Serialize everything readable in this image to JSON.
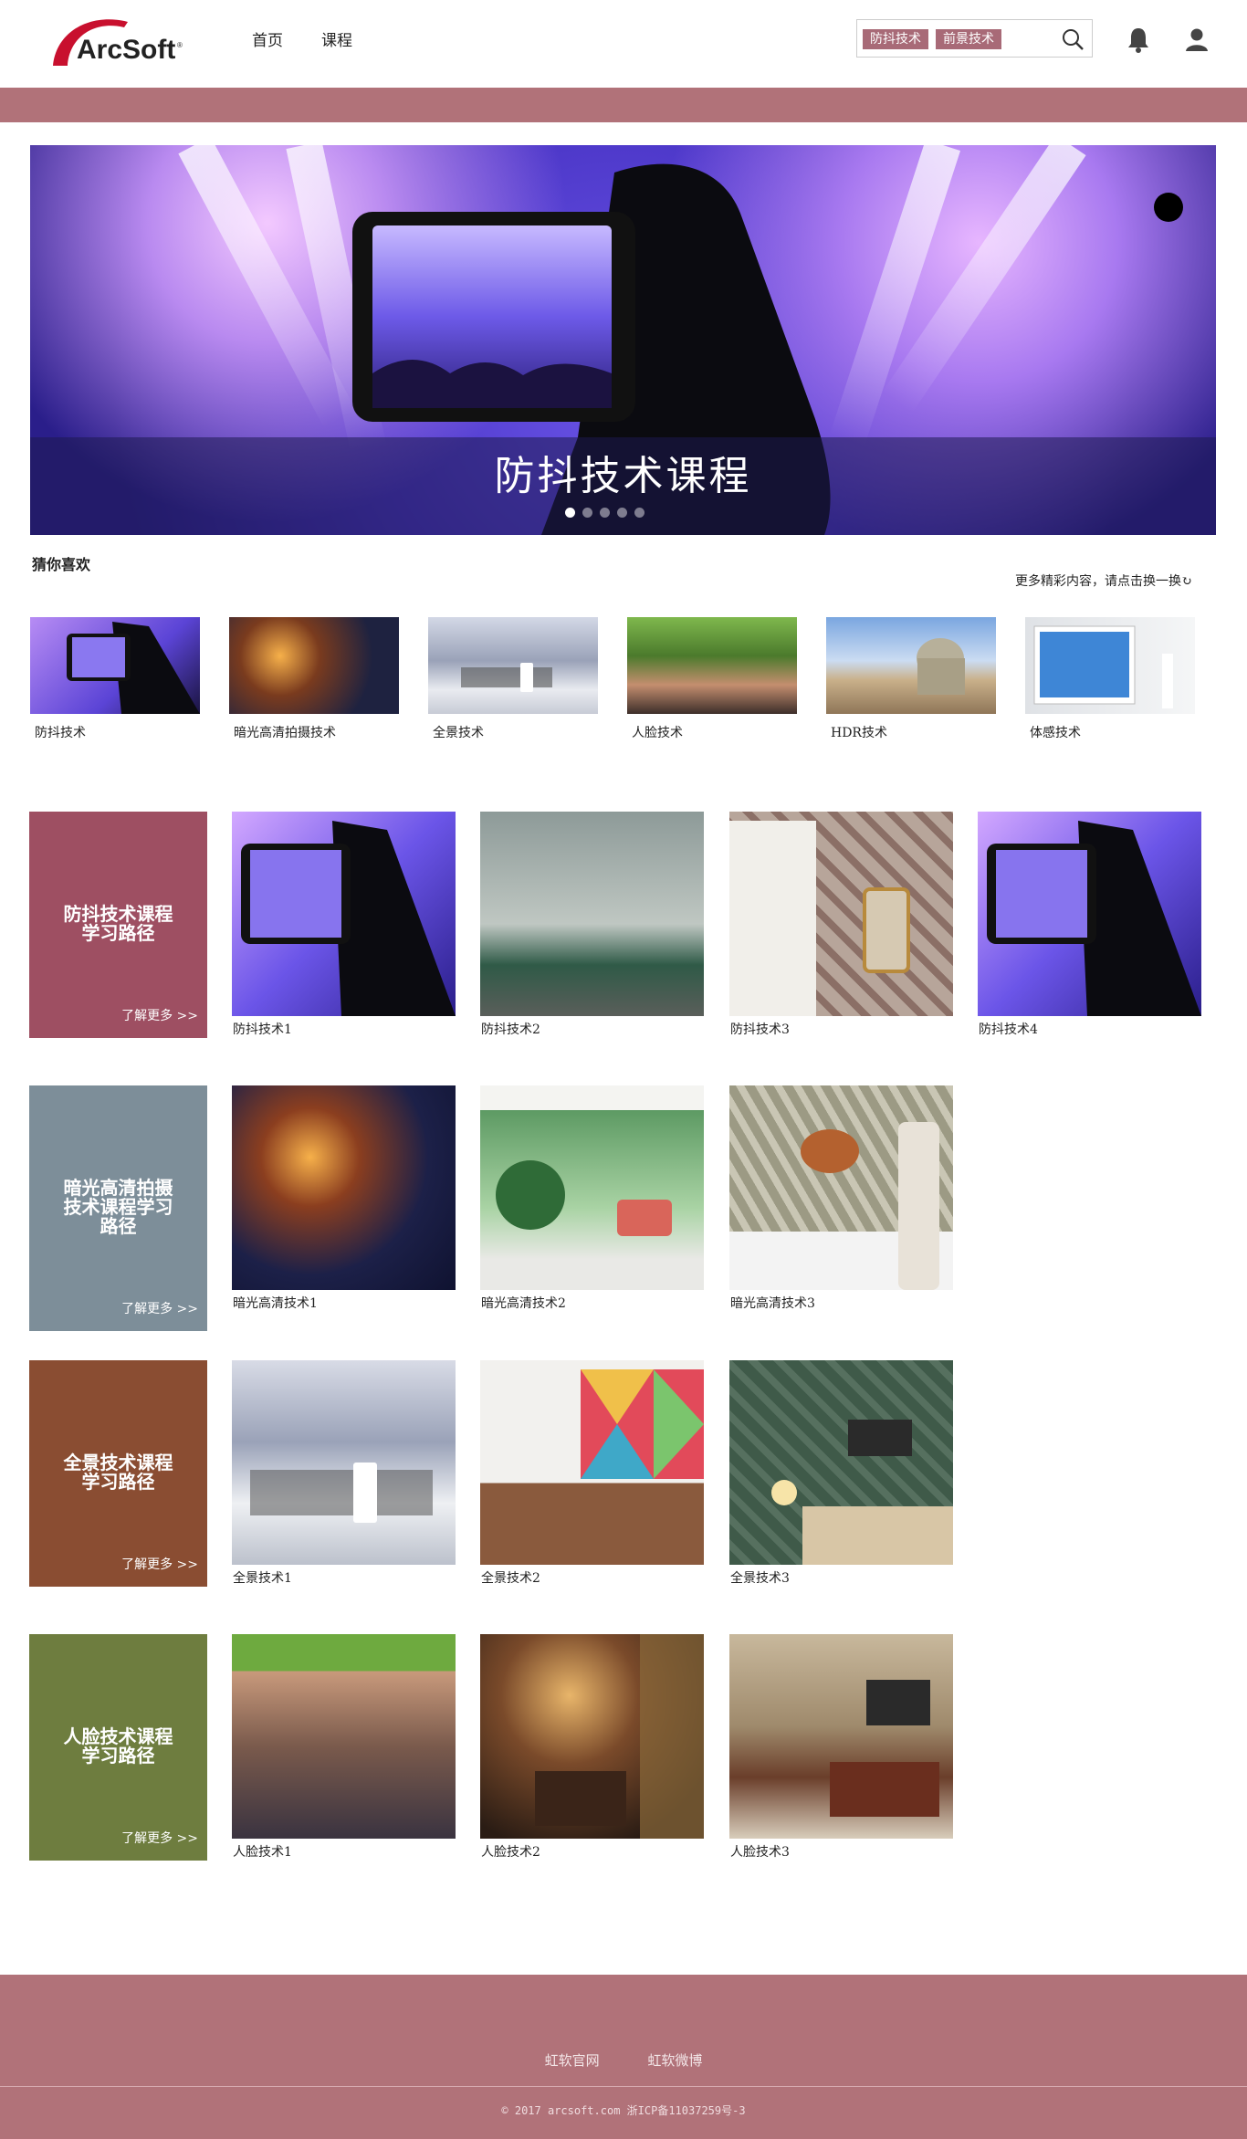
{
  "header": {
    "logo_text": "ArcSoft",
    "nav": [
      "首页",
      "课程"
    ],
    "search_tags": [
      "防抖技术",
      "前景技术"
    ]
  },
  "banner": {
    "title": "防抖技术课程",
    "dots_total": 5,
    "active_dot": 1
  },
  "guess": {
    "title": "猜你喜欢",
    "more_text": "更多精彩内容，请点击换一换",
    "items": [
      "防抖技术",
      "暗光高清拍摄技术",
      "全景技术",
      "人脸技术",
      "HDR技术",
      "体感技术"
    ]
  },
  "courses": [
    {
      "title_lines": [
        "防抖技术课程",
        "学习路径"
      ],
      "more": "了解更多 >>",
      "color": "#9e4f62",
      "items": [
        "防抖技术1",
        "防抖技术2",
        "防抖技术3",
        "防抖技术4"
      ]
    },
    {
      "title_lines": [
        "暗光高清拍摄",
        "技术课程学习",
        "路径"
      ],
      "more": "了解更多 >>",
      "color": "#7d8e99",
      "items": [
        "暗光高清技术1",
        "暗光高清技术2",
        "暗光高清技术3"
      ]
    },
    {
      "title_lines": [
        "全景技术课程",
        "学习路径"
      ],
      "more": "了解更多 >>",
      "color": "#8a4d32",
      "items": [
        "全景技术1",
        "全景技术2",
        "全景技术3"
      ]
    },
    {
      "title_lines": [
        "人脸技术课程",
        "学习路径"
      ],
      "more": "了解更多 >>",
      "color": "#6e7d3f",
      "items": [
        "人脸技术1",
        "人脸技术2",
        "人脸技术3"
      ]
    }
  ],
  "footer": {
    "links": [
      "虹软官网",
      "虹软微博"
    ],
    "copyright": "© 2017 arcsoft.com  浙ICP备11037259号-3"
  },
  "colors": {
    "brand": "#b17279",
    "tag": "#a86a77"
  }
}
